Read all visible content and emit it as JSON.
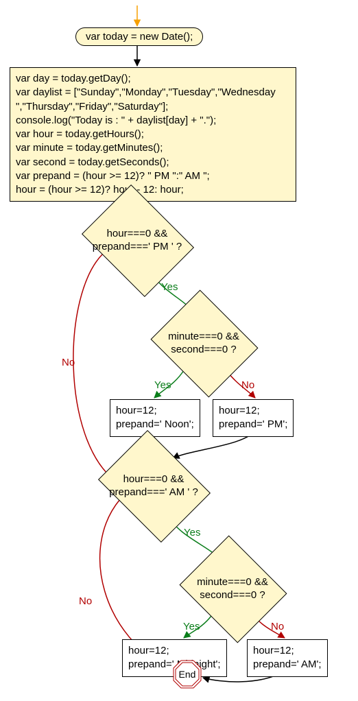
{
  "start": {
    "text": "var today = new Date();"
  },
  "code_block": {
    "text": "var day = today.getDay();\nvar daylist = [\"Sunday\",\"Monday\",\"Tuesday\",\"Wednesday\n\",\"Thursday\",\"Friday\",\"Saturday\"];\nconsole.log(\"Today is : \" + daylist[day] + \".\");\nvar hour = today.getHours();\nvar minute = today.getMinutes();\nvar second = today.getSeconds();\nvar prepand = (hour >= 12)? \" PM \":\" AM \";\nhour = (hour >= 12)? hour - 12: hour;"
  },
  "decision1": {
    "text": "hour===0 &&\nprepand===' PM ' ?"
  },
  "decision2": {
    "text": "minute===0 &&\nsecond===0 ?"
  },
  "decision3": {
    "text": "hour===0 &&\nprepand===' AM ' ?"
  },
  "decision4": {
    "text": "minute===0 &&\nsecond===0 ?"
  },
  "proc_noon": {
    "text": "hour=12;\nprepand=' Noon';"
  },
  "proc_pm": {
    "text": "hour=12;\nprepand=' PM';"
  },
  "proc_midnight": {
    "text": "hour=12;\nprepand=' Midnight';"
  },
  "proc_am": {
    "text": "hour=12;\nprepand=' AM';"
  },
  "end": {
    "text": "End"
  },
  "labels": {
    "yes": "Yes",
    "no": "No"
  },
  "chart_data": {
    "type": "flowchart",
    "nodes": [
      {
        "id": "start",
        "kind": "start",
        "text": "var today = new Date();"
      },
      {
        "id": "code",
        "kind": "process",
        "text": "var day = today.getDay();\nvar daylist = [\"Sunday\",\"Monday\",\"Tuesday\",\"Wednesday\",\"Thursday\",\"Friday\",\"Saturday\"];\nconsole.log(\"Today is : \" + daylist[day] + \".\");\nvar hour = today.getHours();\nvar minute = today.getMinutes();\nvar second = today.getSeconds();\nvar prepand = (hour >= 12)? \" PM \":\" AM \";\nhour = (hour >= 12)? hour - 12: hour;"
      },
      {
        "id": "d1",
        "kind": "decision",
        "text": "hour===0 && prepand===' PM ' ?"
      },
      {
        "id": "d2",
        "kind": "decision",
        "text": "minute===0 && second===0 ?"
      },
      {
        "id": "p_noon",
        "kind": "process",
        "text": "hour=12; prepand=' Noon';"
      },
      {
        "id": "p_pm",
        "kind": "process",
        "text": "hour=12; prepand=' PM';"
      },
      {
        "id": "d3",
        "kind": "decision",
        "text": "hour===0 && prepand===' AM ' ?"
      },
      {
        "id": "d4",
        "kind": "decision",
        "text": "minute===0 && second===0 ?"
      },
      {
        "id": "p_mid",
        "kind": "process",
        "text": "hour=12; prepand=' Midnight';"
      },
      {
        "id": "p_am",
        "kind": "process",
        "text": "hour=12; prepand=' AM';"
      },
      {
        "id": "end",
        "kind": "end",
        "text": "End"
      }
    ],
    "edges": [
      {
        "from": "start",
        "to": "code"
      },
      {
        "from": "code",
        "to": "d1"
      },
      {
        "from": "d1",
        "to": "d2",
        "label": "Yes"
      },
      {
        "from": "d1",
        "to": "d3",
        "label": "No"
      },
      {
        "from": "d2",
        "to": "p_noon",
        "label": "Yes"
      },
      {
        "from": "d2",
        "to": "p_pm",
        "label": "No"
      },
      {
        "from": "p_noon",
        "to": "d3"
      },
      {
        "from": "p_pm",
        "to": "d3"
      },
      {
        "from": "d3",
        "to": "d4",
        "label": "Yes"
      },
      {
        "from": "d3",
        "to": "end",
        "label": "No"
      },
      {
        "from": "d4",
        "to": "p_mid",
        "label": "Yes"
      },
      {
        "from": "d4",
        "to": "p_am",
        "label": "No"
      },
      {
        "from": "p_mid",
        "to": "end"
      },
      {
        "from": "p_am",
        "to": "end"
      }
    ]
  }
}
